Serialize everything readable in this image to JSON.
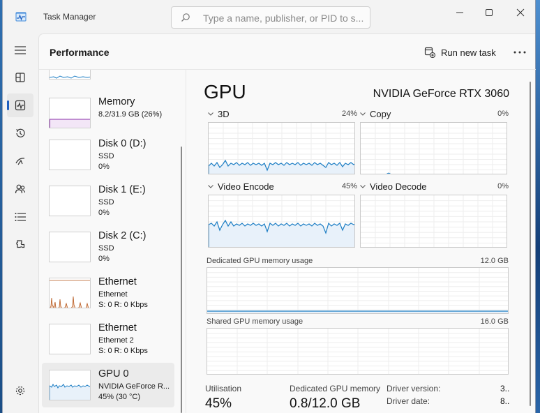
{
  "window": {
    "title": "Task Manager",
    "search_placeholder": "Type a name, publisher, or PID to s...",
    "minimize": "—",
    "maximize": "☐",
    "close": "✕"
  },
  "header": {
    "title": "Performance",
    "run_new_task": "Run new task",
    "more": "···"
  },
  "nav": [
    "hamburger-icon",
    "processes-icon",
    "performance-icon",
    "app-history-icon",
    "startup-apps-icon",
    "users-icon",
    "details-icon",
    "services-icon",
    "settings-icon"
  ],
  "devices": [
    {
      "name": "Memory",
      "sub1": "8.2/31.9 GB (26%)",
      "sub2": "",
      "color": "#8b2fa8"
    },
    {
      "name": "Disk 0 (D:)",
      "sub1": "SSD",
      "sub2": "0%",
      "color": "#4c9a2a"
    },
    {
      "name": "Disk 1 (E:)",
      "sub1": "SSD",
      "sub2": "0%",
      "color": "#4c9a2a"
    },
    {
      "name": "Disk 2 (C:)",
      "sub1": "SSD",
      "sub2": "0%",
      "color": "#4c9a2a"
    },
    {
      "name": "Ethernet",
      "sub1": "Ethernet",
      "sub2": "S: 0  R: 0 Kbps",
      "color": "#b5561b"
    },
    {
      "name": "Ethernet",
      "sub1": "Ethernet 2",
      "sub2": "S: 0  R: 0 Kbps",
      "color": "#b5561b"
    },
    {
      "name": "GPU 0",
      "sub1": "NVIDIA GeForce R...",
      "sub2": "45%  (30 °C)",
      "color": "#1b7dc4"
    }
  ],
  "gpu": {
    "title": "GPU",
    "model": "NVIDIA GeForce RTX 3060",
    "engines": [
      {
        "name": "3D",
        "pct": "24%"
      },
      {
        "name": "Copy",
        "pct": "0%"
      },
      {
        "name": "Video Encode",
        "pct": "45%"
      },
      {
        "name": "Video Decode",
        "pct": "0%"
      }
    ],
    "dedicated_label": "Dedicated GPU memory usage",
    "dedicated_max": "12.0 GB",
    "shared_label": "Shared GPU memory usage",
    "shared_max": "16.0 GB",
    "stats": {
      "utilisation_label": "Utilisation",
      "utilisation_value": "45%",
      "dedicated_label": "Dedicated GPU memory",
      "dedicated_value": "0.8/12.0 GB",
      "driver_version_label": "Driver version:",
      "driver_version_value": "3..",
      "driver_date_label": "Driver date:",
      "driver_date_value": "8.."
    }
  },
  "colors": {
    "gpu_line": "#1b7dc4",
    "gpu_fill": "#e8f1fa",
    "grid": "#eeeeee",
    "accent": "#1f5fbf"
  }
}
